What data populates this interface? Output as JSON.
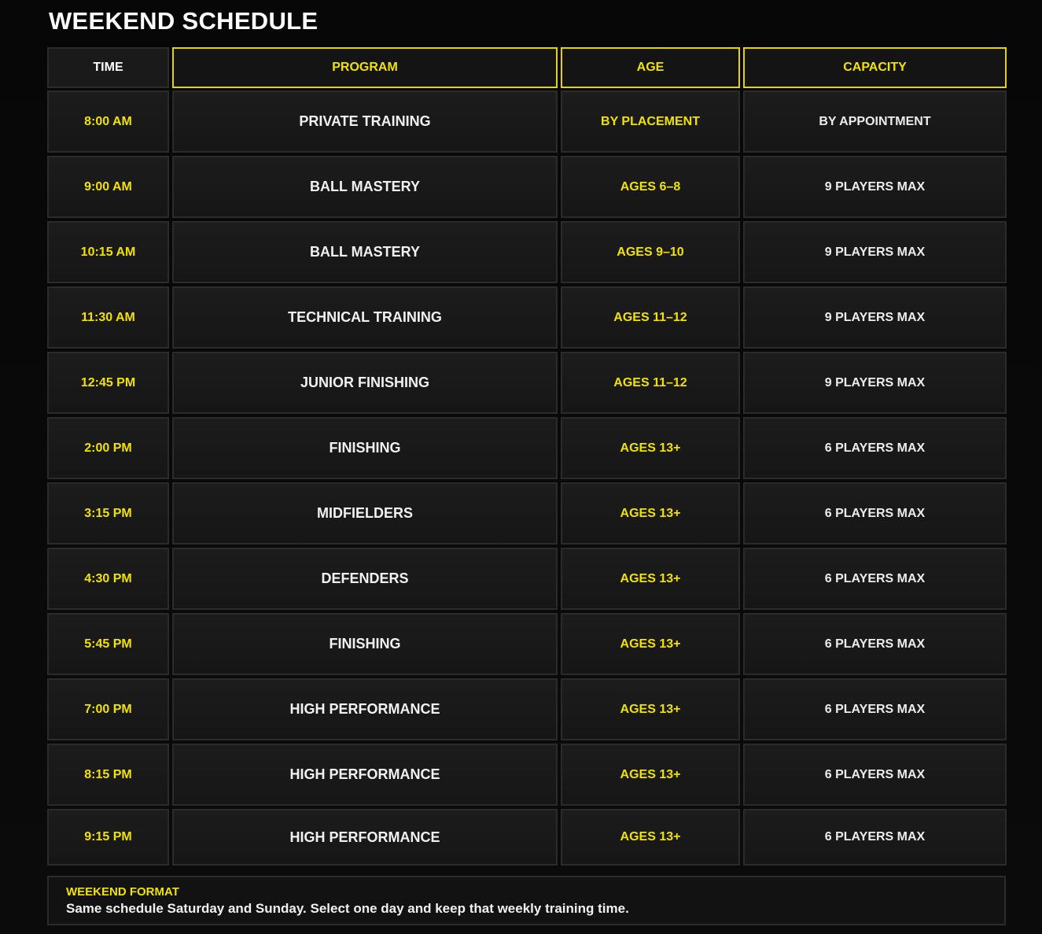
{
  "page": {
    "title": "WEEKEND SCHEDULE"
  },
  "colors": {
    "accent": "#f2e200",
    "background": "#050505",
    "cell": "#1a1a1a",
    "text": "#f1f1f1"
  },
  "table": {
    "headers": {
      "time": "TIME",
      "program": "PROGRAM",
      "age": "AGE",
      "capacity": "CAPACITY"
    },
    "rows": [
      {
        "time": "8:00 AM",
        "program": "PRIVATE TRAINING",
        "age": "BY PLACEMENT",
        "capacity": "BY APPOINTMENT"
      },
      {
        "time": "9:00 AM",
        "program": "BALL MASTERY",
        "age": "AGES 6–8",
        "capacity": "9 PLAYERS MAX"
      },
      {
        "time": "10:15 AM",
        "program": "BALL MASTERY",
        "age": "AGES 9–10",
        "capacity": "9 PLAYERS MAX"
      },
      {
        "time": "11:30 AM",
        "program": "TECHNICAL TRAINING",
        "age": "AGES 11–12",
        "capacity": "9 PLAYERS MAX"
      },
      {
        "time": "12:45 PM",
        "program": "JUNIOR FINISHING",
        "age": "AGES 11–12",
        "capacity": "9 PLAYERS MAX"
      },
      {
        "time": "2:00 PM",
        "program": "FINISHING",
        "age": "AGES 13+",
        "capacity": "6 PLAYERS MAX"
      },
      {
        "time": "3:15 PM",
        "program": "MIDFIELDERS",
        "age": "AGES 13+",
        "capacity": "6 PLAYERS MAX"
      },
      {
        "time": "4:30 PM",
        "program": "DEFENDERS",
        "age": "AGES 13+",
        "capacity": "6 PLAYERS MAX"
      },
      {
        "time": "5:45 PM",
        "program": "FINISHING",
        "age": "AGES 13+",
        "capacity": "6 PLAYERS MAX"
      },
      {
        "time": "7:00 PM",
        "program": "HIGH PERFORMANCE",
        "age": "AGES 13+",
        "capacity": "6 PLAYERS MAX"
      },
      {
        "time": "8:15 PM",
        "program": "HIGH PERFORMANCE",
        "age": "AGES 13+",
        "capacity": "6 PLAYERS MAX"
      },
      {
        "time": "9:15 PM",
        "program": "HIGH PERFORMANCE",
        "age": "AGES 13+",
        "capacity": "6 PLAYERS MAX"
      }
    ]
  },
  "note": {
    "title": "WEEKEND FORMAT",
    "text": "Same schedule Saturday and Sunday. Select one day and keep that weekly training time."
  }
}
